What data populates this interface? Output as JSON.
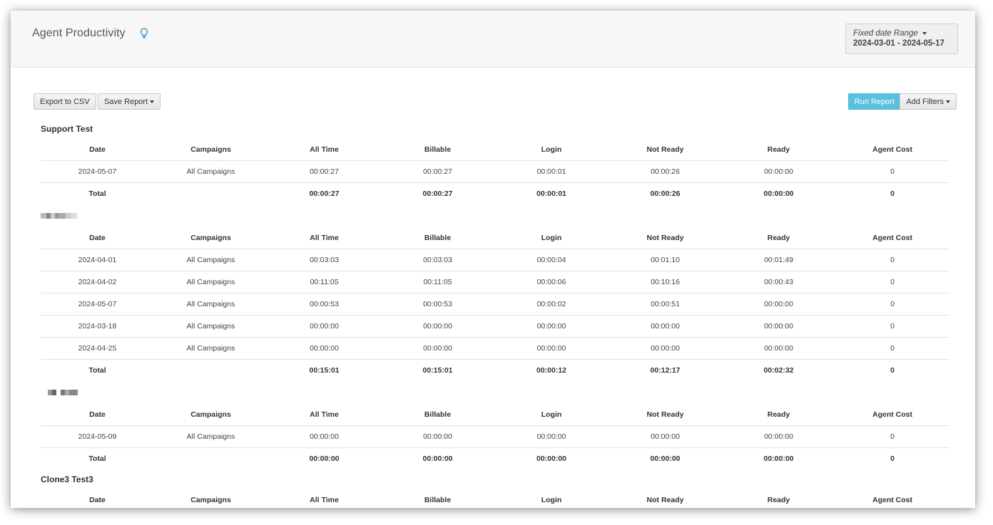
{
  "header": {
    "title": "Agent Productivity",
    "date_range": {
      "label": "Fixed date Range",
      "value": "2024-03-01 - 2024-05-17"
    }
  },
  "toolbar": {
    "export_label": "Export to CSV",
    "save_label": "Save Report",
    "run_label": "Run Report",
    "filters_label": "Add Filters"
  },
  "colors": {
    "primary": "#5bc0de",
    "header_bg": "#f7f7f7"
  },
  "columns": [
    "Date",
    "Campaigns",
    "All Time",
    "Billable",
    "Login",
    "Not Ready",
    "Ready",
    "Agent Cost"
  ],
  "groups": [
    {
      "name": "Support Test",
      "rows": [
        [
          "2024-05-07",
          "All Campaigns",
          "00:00:27",
          "00:00:27",
          "00:00:01",
          "00:00:26",
          "00:00:00",
          "0"
        ]
      ],
      "total": [
        "Total",
        "",
        "00:00:27",
        "00:00:27",
        "00:00:01",
        "00:00:26",
        "00:00:00",
        "0"
      ]
    },
    {
      "name": "",
      "rows": [
        [
          "2024-04-01",
          "All Campaigns",
          "00:03:03",
          "00:03:03",
          "00:00:04",
          "00:01:10",
          "00:01:49",
          "0"
        ],
        [
          "2024-04-02",
          "All Campaigns",
          "00:11:05",
          "00:11:05",
          "00:00:06",
          "00:10:16",
          "00:00:43",
          "0"
        ],
        [
          "2024-05-07",
          "All Campaigns",
          "00:00:53",
          "00:00:53",
          "00:00:02",
          "00:00:51",
          "00:00:00",
          "0"
        ],
        [
          "2024-03-18",
          "All Campaigns",
          "00:00:00",
          "00:00:00",
          "00:00:00",
          "00:00:00",
          "00:00:00",
          "0"
        ],
        [
          "2024-04-25",
          "All Campaigns",
          "00:00:00",
          "00:00:00",
          "00:00:00",
          "00:00:00",
          "00:00:00",
          "0"
        ]
      ],
      "total": [
        "Total",
        "",
        "00:15:01",
        "00:15:01",
        "00:00:12",
        "00:12:17",
        "00:02:32",
        "0"
      ]
    },
    {
      "name": "",
      "rows": [
        [
          "2024-05-09",
          "All Campaigns",
          "00:00:00",
          "00:00:00",
          "00:00:00",
          "00:00:00",
          "00:00:00",
          "0"
        ]
      ],
      "total": [
        "Total",
        "",
        "00:00:00",
        "00:00:00",
        "00:00:00",
        "00:00:00",
        "00:00:00",
        "0"
      ]
    },
    {
      "name": "Clone3 Test3",
      "rows": [],
      "total": null
    }
  ]
}
